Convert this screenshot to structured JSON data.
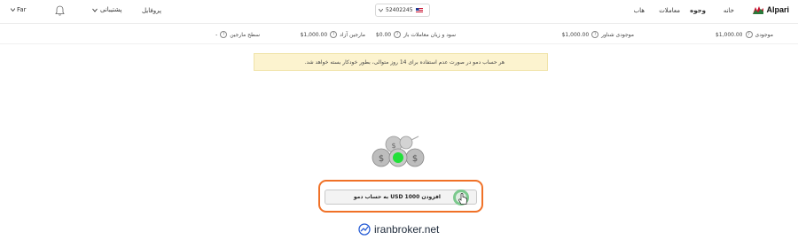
{
  "header": {
    "brand": "Alpari",
    "nav": [
      "خانه",
      "وجوه",
      "معاملات",
      "هاب"
    ],
    "active_nav": "وجوه",
    "account_number": "52402245",
    "profile": "پروفایل",
    "support": "پشتیبانی",
    "language": "Far"
  },
  "metrics": [
    {
      "label": "موجودی",
      "value": "$1,000.00"
    },
    {
      "label": "موجودی شناور",
      "value": "$1,000.00"
    },
    {
      "label": "سود و زیان معاملات باز",
      "value": "$0.00"
    },
    {
      "label": "مارجین آزاد",
      "value": "$1,000.00"
    },
    {
      "label": "سطح مارجین",
      "value": "-"
    }
  ],
  "notice": "هر حساب دمو در صورت عدم استفاده برای 14 روز متوالی، بطور خودکار بسته خواهد شد.",
  "action": {
    "label": "افزودن USD 1000 به حساب دمو"
  },
  "watermark": "iranbroker.net",
  "colors": {
    "highlight": "#f07127",
    "notice_bg": "#fcf3cf",
    "cursor_ring": "#7bc98d"
  }
}
